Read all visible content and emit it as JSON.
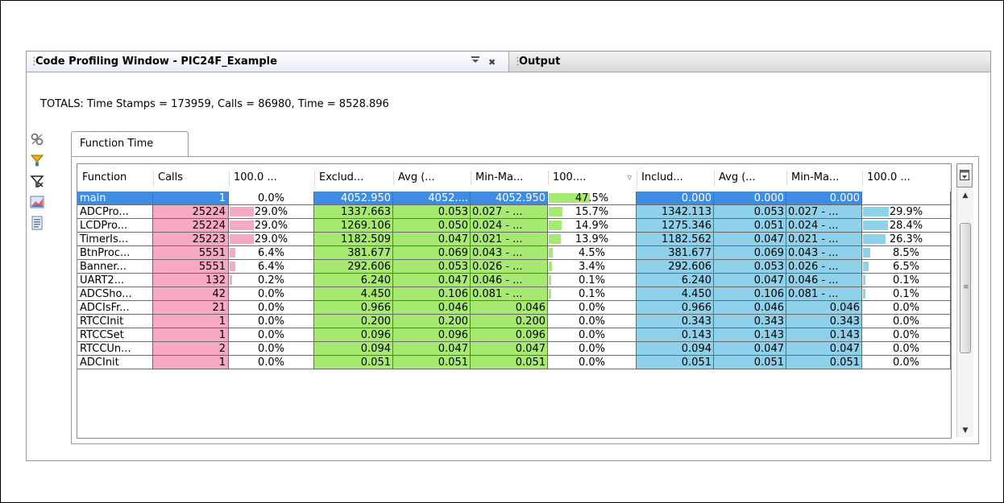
{
  "window": {
    "title": "Code Profiling Window - PIC24F_Example",
    "output_tab": "Output",
    "totals": "TOTALS: Time Stamps = 173959, Calls = 86980, Time = 8528.896",
    "function_tab": "Function Time"
  },
  "icons": [
    "settings-icon",
    "filter-icon",
    "filter-clear-icon",
    "chart-icon",
    "report-icon",
    "column-chooser-icon",
    "sort-descending-icon"
  ],
  "colors": {
    "calls": "#f7a8c3",
    "exclusive": "#a6ea72",
    "inclusive": "#8fd0ea",
    "selection": "#3d8ee3"
  },
  "columns": [
    "Function",
    "Calls",
    "100.0 ...",
    "Exclud...",
    "Avg (...",
    "Min-Ma...",
    "100....",
    "Includ...",
    "Avg (...",
    "Min-Ma...",
    "100.0 ..."
  ],
  "rows": [
    {
      "name": "main",
      "calls": "1",
      "calls_pct": "0.0%",
      "excl": "4052.950",
      "excl_avg": "4052....",
      "excl_minmax": "4052.950",
      "excl_pct": "47.5%",
      "incl": "0.000",
      "incl_avg": "0.000",
      "incl_minmax": "0.000",
      "incl_pct": ""
    },
    {
      "name": "ADCPro...",
      "calls": "25224",
      "calls_pct": "29.0%",
      "excl": "1337.663",
      "excl_avg": "0.053",
      "excl_minmax": "0.027 - ...",
      "excl_pct": "15.7%",
      "incl": "1342.113",
      "incl_avg": "0.053",
      "incl_minmax": "0.027 - ...",
      "incl_pct": "29.9%"
    },
    {
      "name": "LCDPro...",
      "calls": "25224",
      "calls_pct": "29.0%",
      "excl": "1269.106",
      "excl_avg": "0.050",
      "excl_minmax": "0.024 - ...",
      "excl_pct": "14.9%",
      "incl": "1275.346",
      "incl_avg": "0.051",
      "incl_minmax": "0.024 - ...",
      "incl_pct": "28.4%"
    },
    {
      "name": "TimerIs...",
      "calls": "25223",
      "calls_pct": "29.0%",
      "excl": "1182.509",
      "excl_avg": "0.047",
      "excl_minmax": "0.021 - ...",
      "excl_pct": "13.9%",
      "incl": "1182.562",
      "incl_avg": "0.047",
      "incl_minmax": "0.021 - ...",
      "incl_pct": "26.3%"
    },
    {
      "name": "BtnProc...",
      "calls": "5551",
      "calls_pct": "6.4%",
      "excl": "381.677",
      "excl_avg": "0.069",
      "excl_minmax": "0.043 - ...",
      "excl_pct": "4.5%",
      "incl": "381.677",
      "incl_avg": "0.069",
      "incl_minmax": "0.043 - ...",
      "incl_pct": "8.5%"
    },
    {
      "name": "Banner...",
      "calls": "5551",
      "calls_pct": "6.4%",
      "excl": "292.606",
      "excl_avg": "0.053",
      "excl_minmax": "0.026 - ...",
      "excl_pct": "3.4%",
      "incl": "292.606",
      "incl_avg": "0.053",
      "incl_minmax": "0.026 - ...",
      "incl_pct": "6.5%"
    },
    {
      "name": "UART2...",
      "calls": "132",
      "calls_pct": "0.2%",
      "excl": "6.240",
      "excl_avg": "0.047",
      "excl_minmax": "0.046 - ...",
      "excl_pct": "0.1%",
      "incl": "6.240",
      "incl_avg": "0.047",
      "incl_minmax": "0.046 - ...",
      "incl_pct": "0.1%"
    },
    {
      "name": "ADCSho...",
      "calls": "42",
      "calls_pct": "0.0%",
      "excl": "4.450",
      "excl_avg": "0.106",
      "excl_minmax": "0.081 - ...",
      "excl_pct": "0.1%",
      "incl": "4.450",
      "incl_avg": "0.106",
      "incl_minmax": "0.081 - ...",
      "incl_pct": "0.1%"
    },
    {
      "name": "ADCIsFr...",
      "calls": "21",
      "calls_pct": "0.0%",
      "excl": "0.966",
      "excl_avg": "0.046",
      "excl_minmax": "0.046",
      "excl_pct": "0.0%",
      "incl": "0.966",
      "incl_avg": "0.046",
      "incl_minmax": "0.046",
      "incl_pct": "0.0%"
    },
    {
      "name": "RTCCInit",
      "calls": "1",
      "calls_pct": "0.0%",
      "excl": "0.200",
      "excl_avg": "0.200",
      "excl_minmax": "0.200",
      "excl_pct": "0.0%",
      "incl": "0.343",
      "incl_avg": "0.343",
      "incl_minmax": "0.343",
      "incl_pct": "0.0%"
    },
    {
      "name": "RTCCSet",
      "calls": "1",
      "calls_pct": "0.0%",
      "excl": "0.096",
      "excl_avg": "0.096",
      "excl_minmax": "0.096",
      "excl_pct": "0.0%",
      "incl": "0.143",
      "incl_avg": "0.143",
      "incl_minmax": "0.143",
      "incl_pct": "0.0%"
    },
    {
      "name": "RTCCUn...",
      "calls": "2",
      "calls_pct": "0.0%",
      "excl": "0.094",
      "excl_avg": "0.047",
      "excl_minmax": "0.047",
      "excl_pct": "0.0%",
      "incl": "0.094",
      "incl_avg": "0.047",
      "incl_minmax": "0.047",
      "incl_pct": "0.0%"
    },
    {
      "name": "ADCInit",
      "calls": "1",
      "calls_pct": "0.0%",
      "excl": "0.051",
      "excl_avg": "0.051",
      "excl_minmax": "0.051",
      "excl_pct": "0.0%",
      "incl": "0.051",
      "incl_avg": "0.051",
      "incl_minmax": "0.051",
      "incl_pct": "0.0%"
    }
  ]
}
